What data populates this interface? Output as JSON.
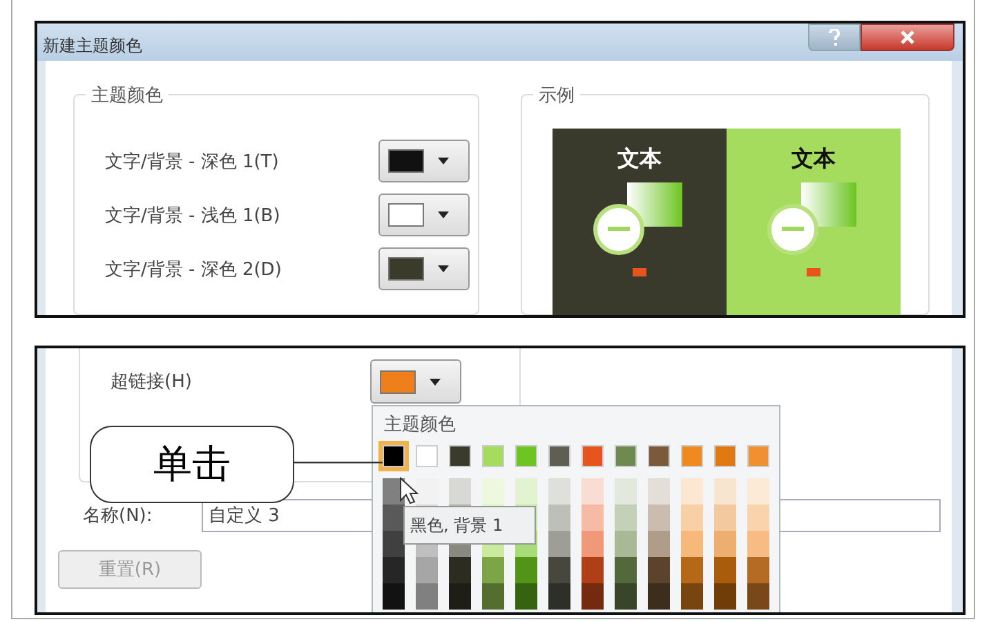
{
  "dialog": {
    "title": "新建主题颜色"
  },
  "theme_colors": {
    "legend": "主题颜色",
    "rows": [
      {
        "label": "文字/背景 - 深色 1(T)",
        "color": "#111111"
      },
      {
        "label": "文字/背景 - 浅色 1(B)",
        "color": "#ffffff"
      },
      {
        "label": "文字/背景 - 深色 2(D)",
        "color": "#3b3b2b"
      }
    ]
  },
  "sample": {
    "legend": "示例",
    "panels": [
      {
        "text": "文本",
        "color": "#3a3a2c"
      },
      {
        "text": "文本",
        "color": "#a6dc5e"
      }
    ]
  },
  "hyperlink": {
    "label": "超链接(H)",
    "color": "#ee7f1a"
  },
  "callout": {
    "text": "单击"
  },
  "name": {
    "label": "名称(N):",
    "value": "自定义 3"
  },
  "reset_button": "重置(R)",
  "palette": {
    "header": "主题颜色",
    "tooltip": "黑色, 背景 1",
    "swatches": [
      {
        "color": "#000000",
        "selected": true
      },
      {
        "color": "#ffffff",
        "selected": false
      },
      {
        "color": "#3b3b2b",
        "selected": false
      },
      {
        "color": "#a6dc5e",
        "selected": false
      },
      {
        "color": "#6cc520",
        "selected": false
      },
      {
        "color": "#5e5e52",
        "selected": false
      },
      {
        "color": "#e8541e",
        "selected": false
      },
      {
        "color": "#6f8a4f",
        "selected": false
      },
      {
        "color": "#7a5a3a",
        "selected": false
      },
      {
        "color": "#f08a20",
        "selected": false
      },
      {
        "color": "#e07a10",
        "selected": false
      },
      {
        "color": "#f09030",
        "selected": false
      }
    ]
  }
}
